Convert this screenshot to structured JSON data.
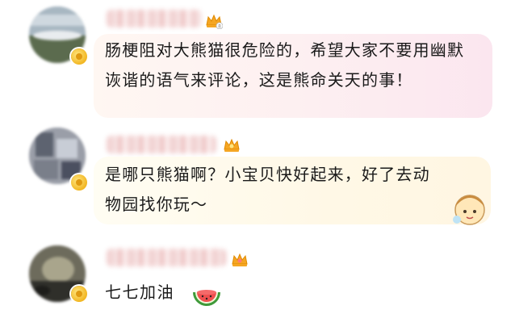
{
  "comments": [
    {
      "text": "肠梗阻对大熊猫很危险的，希望大家不要用幽默诙谐的语气来评论，这是熊命关天的事！",
      "avatar_icon": "landscape-avatar-icon",
      "badge_icon": "gold-medal-icon",
      "level_icon": "crown-level-icon"
    },
    {
      "text": "是哪只熊猫啊？小宝贝快好起来，好了去动物园找你玩～",
      "avatar_icon": "photo-avatar-icon",
      "badge_icon": "gold-medal-icon",
      "level_icon": "crown-level-icon",
      "sticker_icon": "cartoon-girl-sticker-icon"
    },
    {
      "text": "七七加油",
      "avatar_icon": "dark-photo-avatar-icon",
      "badge_icon": "gold-medal-icon",
      "level_icon": "crown-level-icon",
      "emoji_icon": "watermelon-emoji-icon"
    }
  ],
  "colors": {
    "bubble1_start": "#fff7f2",
    "bubble1_end": "#fbe6ef",
    "bubble2_start": "#fffdf3",
    "bubble2_end": "#fff6e2",
    "text": "#1a1a1a",
    "crown": "#f5a623"
  }
}
